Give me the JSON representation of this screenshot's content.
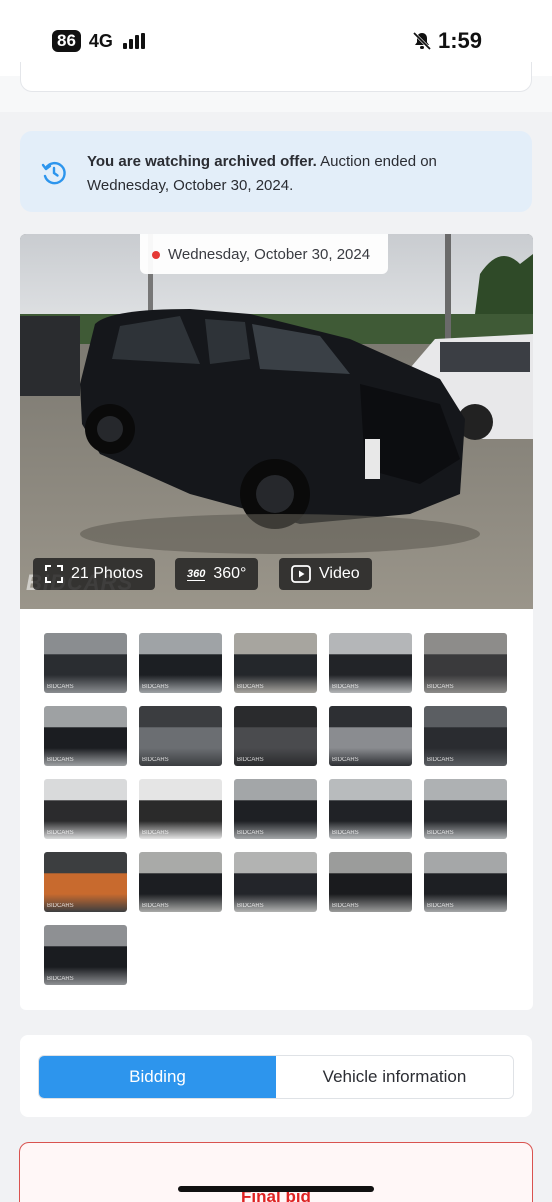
{
  "status_bar": {
    "battery": "86",
    "network": "4G",
    "time": "1:59",
    "icons": [
      "signal-icon",
      "bell-muted-icon"
    ]
  },
  "banner": {
    "icon": "history-icon",
    "bold_text": "You are watching archived offer.",
    "rest_text": " Auction ended on Wednesday, October 30, 2024."
  },
  "hero": {
    "date": "Wednesday, October 30, 2024",
    "photos_label": "21 Photos",
    "view360_label": "360°",
    "view360_icon_text": "360",
    "video_label": "Video",
    "watermark": "BIDCARS"
  },
  "thumbnails": [
    {
      "brand": "BIDCARS"
    },
    {
      "brand": "BIDCARS"
    },
    {
      "brand": "BIDCARS"
    },
    {
      "brand": "BIDCARS"
    },
    {
      "brand": "BIDCARS"
    },
    {
      "brand": "BIDCARS"
    },
    {
      "brand": "BIDCARS"
    },
    {
      "brand": "BIDCARS"
    },
    {
      "brand": "BIDCARS"
    },
    {
      "brand": "BIDCARS"
    },
    {
      "brand": "BIDCARS"
    },
    {
      "brand": "BIDCARS"
    },
    {
      "brand": "BIDCARS"
    },
    {
      "brand": "BIDCARS"
    },
    {
      "brand": "BIDCARS"
    },
    {
      "brand": "BIDCARS"
    },
    {
      "brand": "BIDCARS"
    },
    {
      "brand": "BIDCARS"
    },
    {
      "brand": "BIDCARS"
    },
    {
      "brand": "BIDCARS"
    },
    {
      "brand": "BIDCARS"
    }
  ],
  "tabs": [
    {
      "label": "Bidding",
      "active": true
    },
    {
      "label": "Vehicle information",
      "active": false
    }
  ],
  "final_bid": {
    "label": "Final bid"
  },
  "colors": {
    "accent": "#2d95ed",
    "banner_bg": "#e3eef9",
    "final_border": "#d9534f"
  }
}
